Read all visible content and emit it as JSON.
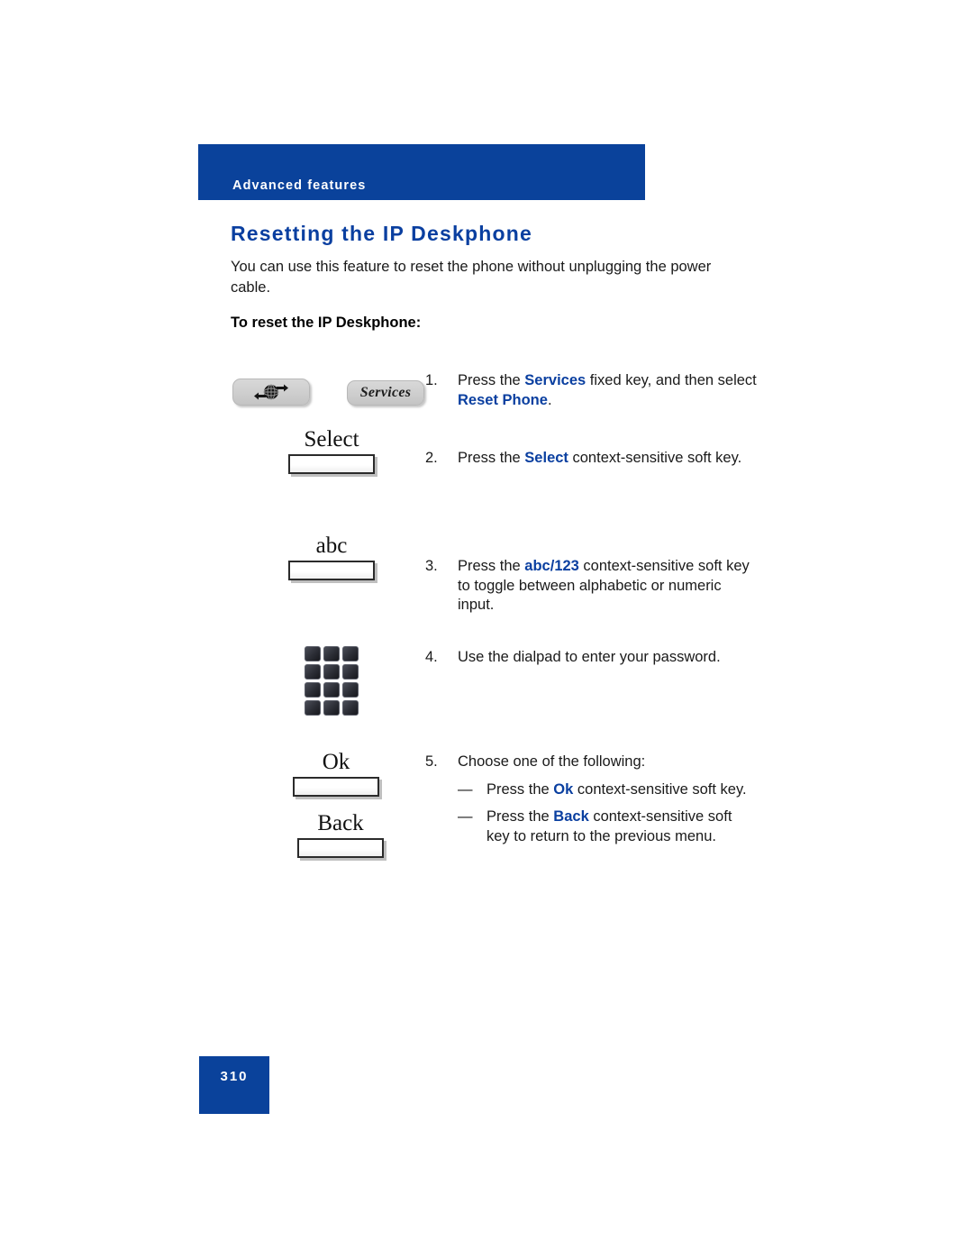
{
  "header": {
    "banner_label": "Advanced features",
    "banner_color": "#0a429b"
  },
  "page_title": "Resetting the IP Deskphone",
  "title_color": "#0a3fa0",
  "intro": "You can use this feature to reset the phone without unplugging the power cable.",
  "subhead": "To reset the IP Deskphone:",
  "fixed_keys": {
    "globe_icon_name": "services-globe-arrows-icon",
    "services_label": "Services"
  },
  "soft_keys": {
    "select": "Select",
    "abc": "abc",
    "ok": "Ok",
    "back": "Back"
  },
  "dialpad": {
    "icon_name": "dialpad-icon",
    "rows": 4,
    "cols": 3
  },
  "steps": [
    {
      "number": "1.",
      "parts": [
        {
          "t": "Press the ",
          "em": false
        },
        {
          "t": "Services",
          "em": true
        },
        {
          "t": " fixed key, and then select ",
          "em": false
        },
        {
          "t": "Reset Phone",
          "em": true
        },
        {
          "t": ".",
          "em": false
        }
      ]
    },
    {
      "number": "2.",
      "parts": [
        {
          "t": "Press the ",
          "em": false
        },
        {
          "t": "Select",
          "em": true
        },
        {
          "t": " context-sensitive soft key.",
          "em": false
        }
      ]
    },
    {
      "number": "3.",
      "parts": [
        {
          "t": "Press the ",
          "em": false
        },
        {
          "t": "abc/123",
          "em": true
        },
        {
          "t": " context-sensitive soft key to toggle between alphabetic or numeric input.",
          "em": false
        }
      ]
    },
    {
      "number": "4.",
      "parts": [
        {
          "t": "Use the dialpad to enter your password.",
          "em": false
        }
      ]
    },
    {
      "number": "5.",
      "parts": [
        {
          "t": "Choose one of the following:",
          "em": false
        }
      ],
      "sub_items": [
        {
          "dash": "—",
          "parts": [
            {
              "t": "Press the ",
              "em": false
            },
            {
              "t": "Ok",
              "em": true
            },
            {
              "t": " context-sensitive soft key.",
              "em": false
            }
          ]
        },
        {
          "dash": "—",
          "parts": [
            {
              "t": "Press the ",
              "em": false
            },
            {
              "t": "Back",
              "em": true
            },
            {
              "t": " context-sensitive soft key to return to the previous menu.",
              "em": false
            }
          ]
        }
      ]
    }
  ],
  "footer": {
    "page_number": "310",
    "color": "#0a429b"
  }
}
